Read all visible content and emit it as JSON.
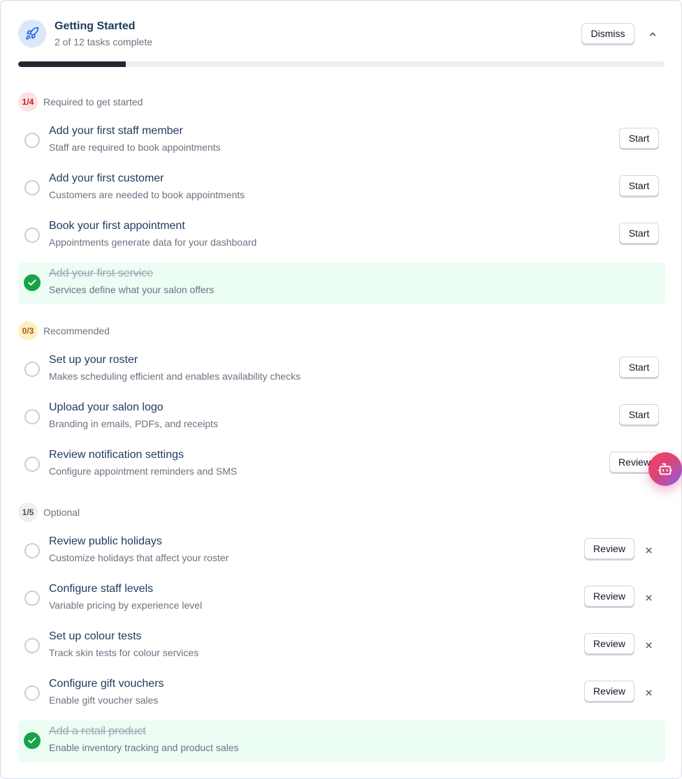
{
  "header": {
    "title": "Getting Started",
    "subtitle": "2 of 12 tasks complete",
    "dismiss_label": "Dismiss",
    "progress_fraction": 0.1667
  },
  "sections": {
    "required": {
      "badge": "1/4",
      "label": "Required to get started",
      "tasks": [
        {
          "title": "Add your first staff member",
          "desc": "Staff are required to book appointments",
          "action": "Start"
        },
        {
          "title": "Add your first customer",
          "desc": "Customers are needed to book appointments",
          "action": "Start"
        },
        {
          "title": "Book your first appointment",
          "desc": "Appointments generate data for your dashboard",
          "action": "Start"
        },
        {
          "title": "Add your first service",
          "desc": "Services define what your salon offers",
          "done": true
        }
      ]
    },
    "recommended": {
      "badge": "0/3",
      "label": "Recommended",
      "tasks": [
        {
          "title": "Set up your roster",
          "desc": "Makes scheduling efficient and enables availability checks",
          "action": "Start"
        },
        {
          "title": "Upload your salon logo",
          "desc": "Branding in emails, PDFs, and receipts",
          "action": "Start"
        },
        {
          "title": "Review notification settings",
          "desc": "Configure appointment reminders and SMS",
          "action": "Review"
        }
      ]
    },
    "optional": {
      "badge": "1/5",
      "label": "Optional",
      "tasks": [
        {
          "title": "Review public holidays",
          "desc": "Customize holidays that affect your roster",
          "action": "Review"
        },
        {
          "title": "Configure staff levels",
          "desc": "Variable pricing by experience level",
          "action": "Review"
        },
        {
          "title": "Set up colour tests",
          "desc": "Track skin tests for colour services",
          "action": "Review"
        },
        {
          "title": "Configure gift vouchers",
          "desc": "Enable gift voucher sales",
          "action": "Review"
        },
        {
          "title": "Add a retail product",
          "desc": "Enable inventory tracking and product sales",
          "done": true
        }
      ]
    }
  },
  "colors": {
    "success": "#16a34a",
    "progress": "#222831",
    "title": "#1e3a5f"
  },
  "icons": {
    "header": "rocket-icon",
    "collapse": "chevron-up-icon",
    "remove": "close-icon",
    "assistant": "bot-icon"
  }
}
